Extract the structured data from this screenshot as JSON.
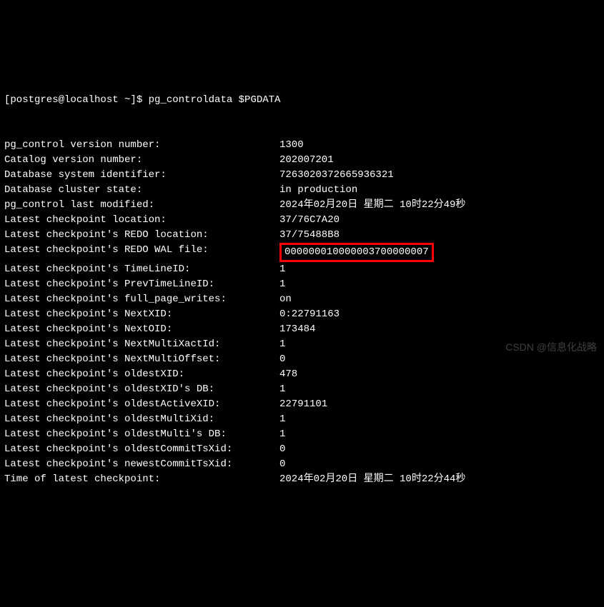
{
  "prompt": "[postgres@localhost ~]$ pg_controldata $PGDATA",
  "rows": [
    {
      "key": "pg_control version number:",
      "val": "1300"
    },
    {
      "key": "Catalog version number:",
      "val": "202007201"
    },
    {
      "key": "Database system identifier:",
      "val": "7263020372665936321"
    },
    {
      "key": "Database cluster state:",
      "val": "in production"
    },
    {
      "key": "pg_control last modified:",
      "val": "2024年02月20日 星期二 10时22分49秒"
    },
    {
      "key": "Latest checkpoint location:",
      "val": "37/76C7A20"
    },
    {
      "key": "Latest checkpoint's REDO location:",
      "val": "37/75488B8"
    },
    {
      "key": "Latest checkpoint's REDO WAL file:",
      "val": "000000010000003700000007",
      "hl": true
    },
    {
      "key": "Latest checkpoint's TimeLineID:",
      "val": "1"
    },
    {
      "key": "Latest checkpoint's PrevTimeLineID:",
      "val": "1"
    },
    {
      "key": "Latest checkpoint's full_page_writes:",
      "val": "on"
    },
    {
      "key": "Latest checkpoint's NextXID:",
      "val": "0:22791163"
    },
    {
      "key": "Latest checkpoint's NextOID:",
      "val": "173484"
    },
    {
      "key": "Latest checkpoint's NextMultiXactId:",
      "val": "1"
    },
    {
      "key": "Latest checkpoint's NextMultiOffset:",
      "val": "0"
    },
    {
      "key": "Latest checkpoint's oldestXID:",
      "val": "478"
    },
    {
      "key": "Latest checkpoint's oldestXID's DB:",
      "val": "1"
    },
    {
      "key": "Latest checkpoint's oldestActiveXID:",
      "val": "22791101"
    },
    {
      "key": "Latest checkpoint's oldestMultiXid:",
      "val": "1"
    },
    {
      "key": "Latest checkpoint's oldestMulti's DB:",
      "val": "1"
    },
    {
      "key": "Latest checkpoint's oldestCommitTsXid:",
      "val": "0"
    },
    {
      "key": "Latest checkpoint's newestCommitTsXid:",
      "val": "0"
    },
    {
      "key": "Time of latest checkpoint:",
      "val": "2024年02月20日 星期二 10时22分44秒"
    }
  ],
  "watermark": "CSDN @信息化战略"
}
